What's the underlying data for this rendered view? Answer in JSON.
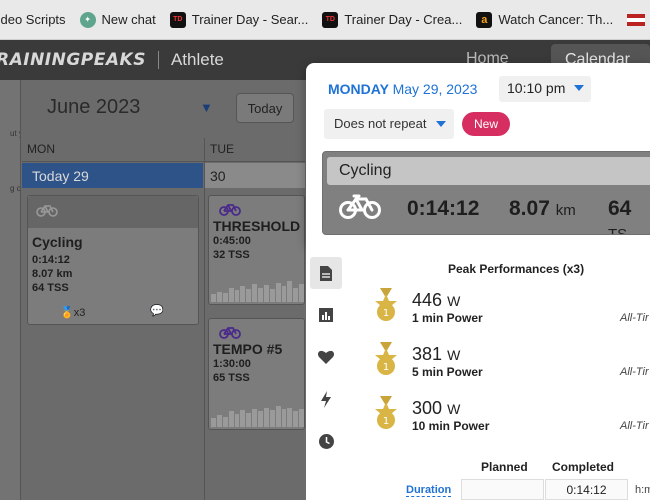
{
  "bookmarks": [
    {
      "label": "/ideo Scripts",
      "icon": "folder-icon"
    },
    {
      "label": "New chat",
      "icon": "chatgpt-icon"
    },
    {
      "label": "Trainer Day - Sear...",
      "icon": "trainerday-icon"
    },
    {
      "label": "Trainer Day - Crea...",
      "icon": "trainerday-icon"
    },
    {
      "label": "Watch Cancer: Th...",
      "icon": "amazon-icon"
    }
  ],
  "appnav": {
    "logo": "RAININGPEAKS",
    "section": "Athlete",
    "home": "Home",
    "calendar": "Calendar"
  },
  "calendar": {
    "left_fragment": "ut y\n\n\n\n\ng o",
    "month": "June 2023",
    "today_button": "Today",
    "days": [
      "MON",
      "TUE"
    ],
    "today_label": "Today 29",
    "next_date": "30",
    "workouts": {
      "mon": {
        "title": "Cycling",
        "duration": "0:14:12",
        "distance": "8.07 km",
        "tss": "64 TSS",
        "medals": "x3"
      },
      "tue1": {
        "title": "THRESHOLD",
        "duration": "0:45:00",
        "tss": "32 TSS"
      },
      "tue2": {
        "title": "TEMPO #5",
        "duration": "1:30:00",
        "tss": "65 TSS"
      }
    }
  },
  "modal": {
    "date_day": "MONDAY",
    "date_rest": "May 29, 2023",
    "time": "10:10 pm",
    "repeat": "Does not repeat",
    "new_button": "New",
    "summary_title": "Cycling",
    "summary_duration": "0:14:12",
    "summary_distance": "8.07",
    "summary_distance_unit": "km",
    "summary_tss": "64",
    "summary_tss_unit": "TS"
  },
  "detail": {
    "peak_title": "Peak Performances (x3)",
    "peaks": [
      {
        "value": "446",
        "unit": "W",
        "label": "1 min Power",
        "scope": "All-Tir"
      },
      {
        "value": "381",
        "unit": "W",
        "label": "5 min Power",
        "scope": "All-Tir"
      },
      {
        "value": "300",
        "unit": "W",
        "label": "10 min Power",
        "scope": "All-Tir"
      }
    ],
    "table": {
      "planned": "Planned",
      "completed": "Completed",
      "row_label": "Duration",
      "completed_value": "0:14:12",
      "unit": "h:m"
    }
  },
  "colors": {
    "accent": "#1f72d6",
    "new_button": "#d62e61",
    "today_bar": "#2e5389"
  }
}
